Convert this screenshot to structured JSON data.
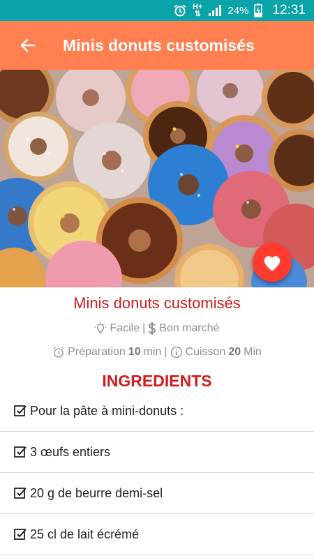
{
  "status_bar": {
    "network": "H+",
    "battery": "24%",
    "time": "12:31"
  },
  "app_bar": {
    "title": "Minis donuts customisés"
  },
  "recipe": {
    "title": "Minis donuts customisés",
    "difficulty": "Facile",
    "cost": "Bon marché",
    "prep_label": "Préparation",
    "prep_value": "10",
    "prep_unit": "min",
    "cook_label": "Cuisson",
    "cook_value": "20",
    "cook_unit": "Min"
  },
  "ingredients_title": "INGREDIENTS",
  "ingredients": [
    "Pour la pâte à mini-donuts :",
    "3 œufs entiers",
    "20 g de beurre demi-sel",
    "25 cl de lait écrémé"
  ],
  "colors": {
    "status": "#0aa3a8",
    "app_bar": "#ff7f50",
    "accent_red": "#d01c1c",
    "fav": "#ff3b30"
  }
}
